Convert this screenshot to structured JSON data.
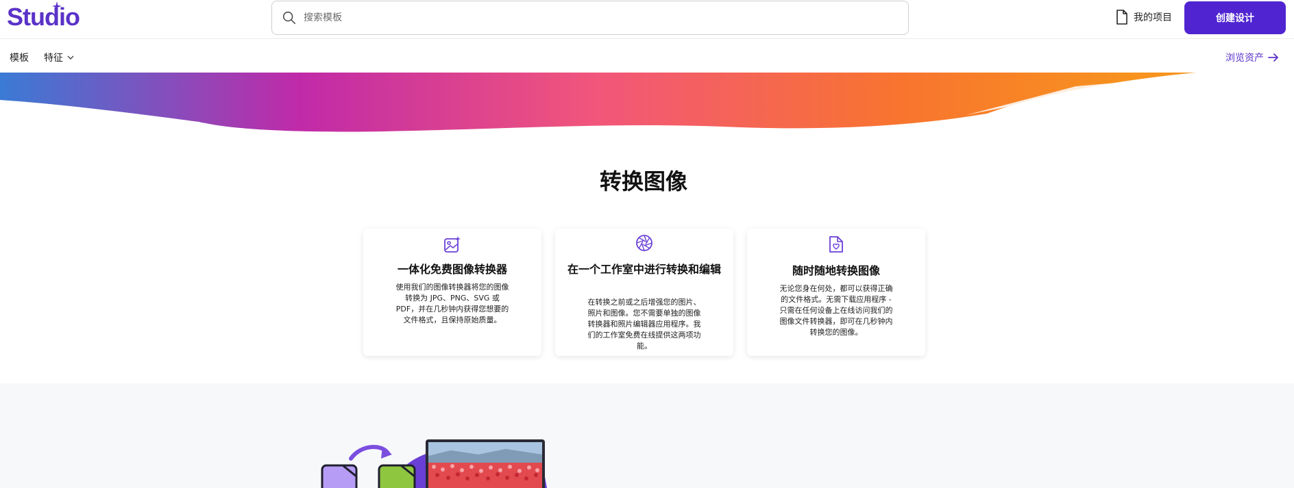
{
  "header": {
    "logo": "Studio",
    "search_placeholder": "搜索模板",
    "my_projects": "我的项目",
    "create_button": "创建设计"
  },
  "subnav": {
    "templates": "模板",
    "features": "特征",
    "browse_assets": "浏览资产"
  },
  "section": {
    "title": "转换图像",
    "cards": [
      {
        "icon": "image-sparkle-icon",
        "title": "一体化免费图像转换器",
        "body": "使用我们的图像转换器将您的图像转换为 JPG、PNG、SVG 或 PDF，并在几秒钟内获得您想要的文件格式，且保持原始质量。"
      },
      {
        "icon": "aperture-icon",
        "title": "在一个工作室中进行转换和编辑",
        "body": "在转换之前或之后增强您的图片、照片和图像。您不需要单独的图像转换器和照片编辑器应用程序。我们的工作室免费在线提供这两项功能。"
      },
      {
        "icon": "file-heart-icon",
        "title": "随时随地转换图像",
        "body": "无论您身在何处，都可以获得正确的文件格式。无需下载应用程序 - 只需在任何设备上在线访问我们的图像文件转换器，即可在几秒钟内转换您的图像。"
      }
    ]
  },
  "colors": {
    "brand": "#5025d1",
    "gradient": [
      "#3a7bd5",
      "#c02aa8",
      "#f2567a",
      "#f7931e"
    ]
  }
}
